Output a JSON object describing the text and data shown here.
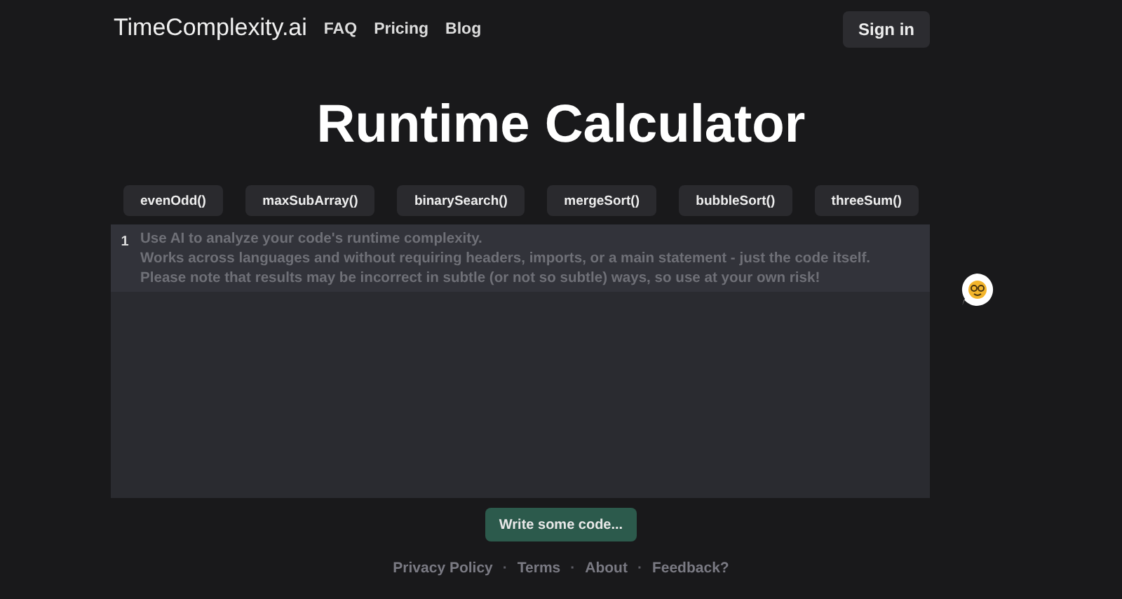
{
  "header": {
    "logo": "TimeComplexity.ai",
    "nav": [
      "FAQ",
      "Pricing",
      "Blog"
    ],
    "sign_in": "Sign in"
  },
  "title": "Runtime Calculator",
  "examples": [
    "evenOdd()",
    "maxSubArray()",
    "binarySearch()",
    "mergeSort()",
    "bubbleSort()",
    "threeSum()"
  ],
  "editor": {
    "line_number": "1",
    "placeholder": "Use AI to analyze your code's runtime complexity.\nWorks across languages and without requiring headers, imports, or a main statement - just the code itself.\nPlease note that results may be incorrect in subtle (or not so subtle) ways, so use at your own risk!"
  },
  "submit": {
    "label": "Write some code...",
    "disabled": true
  },
  "footer": [
    {
      "kind": "link",
      "text": "Privacy Policy"
    },
    {
      "kind": "separator",
      "text": "·"
    },
    {
      "kind": "link",
      "text": "Terms"
    },
    {
      "kind": "separator",
      "text": "·"
    },
    {
      "kind": "link",
      "text": "About"
    },
    {
      "kind": "separator",
      "text": "·"
    },
    {
      "kind": "link",
      "text": "Feedback?"
    }
  ]
}
